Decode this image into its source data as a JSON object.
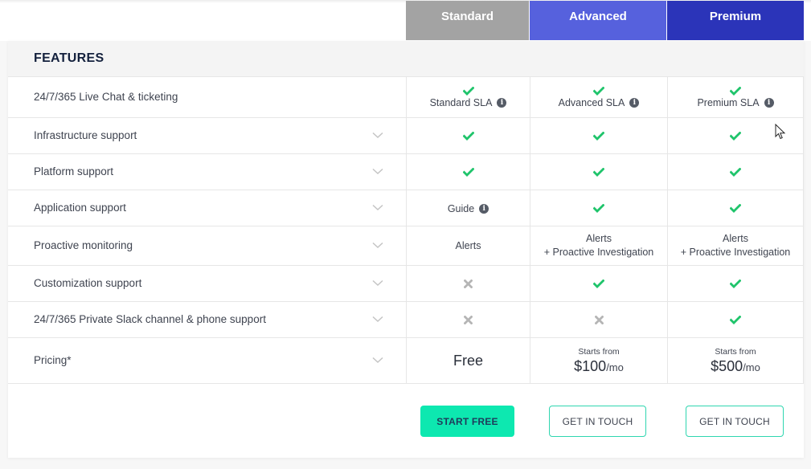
{
  "plans": [
    {
      "name": "Standard",
      "color": "#a3a3a3"
    },
    {
      "name": "Advanced",
      "color": "#5661dd"
    },
    {
      "name": "Premium",
      "color": "#2b34b9"
    }
  ],
  "section_title": "FEATURES",
  "rows": [
    {
      "label": "24/7/365 Live Chat & ticketing",
      "expandable": false,
      "cells": [
        {
          "type": "check",
          "text": "Standard SLA",
          "info": true
        },
        {
          "type": "check",
          "text": "Advanced SLA",
          "info": true
        },
        {
          "type": "check",
          "text": "Premium SLA",
          "info": true
        }
      ]
    },
    {
      "label": "Infrastructure support",
      "expandable": true,
      "cells": [
        {
          "type": "check"
        },
        {
          "type": "check"
        },
        {
          "type": "check"
        }
      ]
    },
    {
      "label": "Platform support",
      "expandable": true,
      "cells": [
        {
          "type": "check"
        },
        {
          "type": "check"
        },
        {
          "type": "check"
        }
      ]
    },
    {
      "label": "Application support",
      "expandable": true,
      "cells": [
        {
          "type": "text",
          "text": "Guide",
          "info": true
        },
        {
          "type": "check"
        },
        {
          "type": "check"
        }
      ]
    },
    {
      "label": "Proactive monitoring",
      "expandable": true,
      "cells": [
        {
          "type": "text",
          "text": "Alerts"
        },
        {
          "type": "text",
          "text": "Alerts",
          "text2": "+ Proactive Investigation"
        },
        {
          "type": "text",
          "text": "Alerts",
          "text2": "+ Proactive Investigation"
        }
      ]
    },
    {
      "label": "Customization support",
      "expandable": true,
      "cells": [
        {
          "type": "cross"
        },
        {
          "type": "check"
        },
        {
          "type": "check"
        }
      ]
    },
    {
      "label": "24/7/365 Private Slack channel & phone support",
      "expandable": true,
      "cells": [
        {
          "type": "cross"
        },
        {
          "type": "cross"
        },
        {
          "type": "check"
        }
      ]
    },
    {
      "label": "Pricing*",
      "expandable": true,
      "cells": [
        {
          "type": "free",
          "text": "Free"
        },
        {
          "type": "price",
          "starts": "Starts from",
          "amount": "$100",
          "per": "/mo"
        },
        {
          "type": "price",
          "starts": "Starts from",
          "amount": "$500",
          "per": "/mo"
        }
      ]
    }
  ],
  "buttons": {
    "start_free": "START FREE",
    "get_in_touch_advanced": "GET IN TOUCH",
    "get_in_touch_premium": "GET IN TOUCH"
  },
  "colors": {
    "check": "#1fc46b",
    "cross": "#b5b5b5",
    "cta": "#0de8b0",
    "outline": "#2fd6b0"
  }
}
